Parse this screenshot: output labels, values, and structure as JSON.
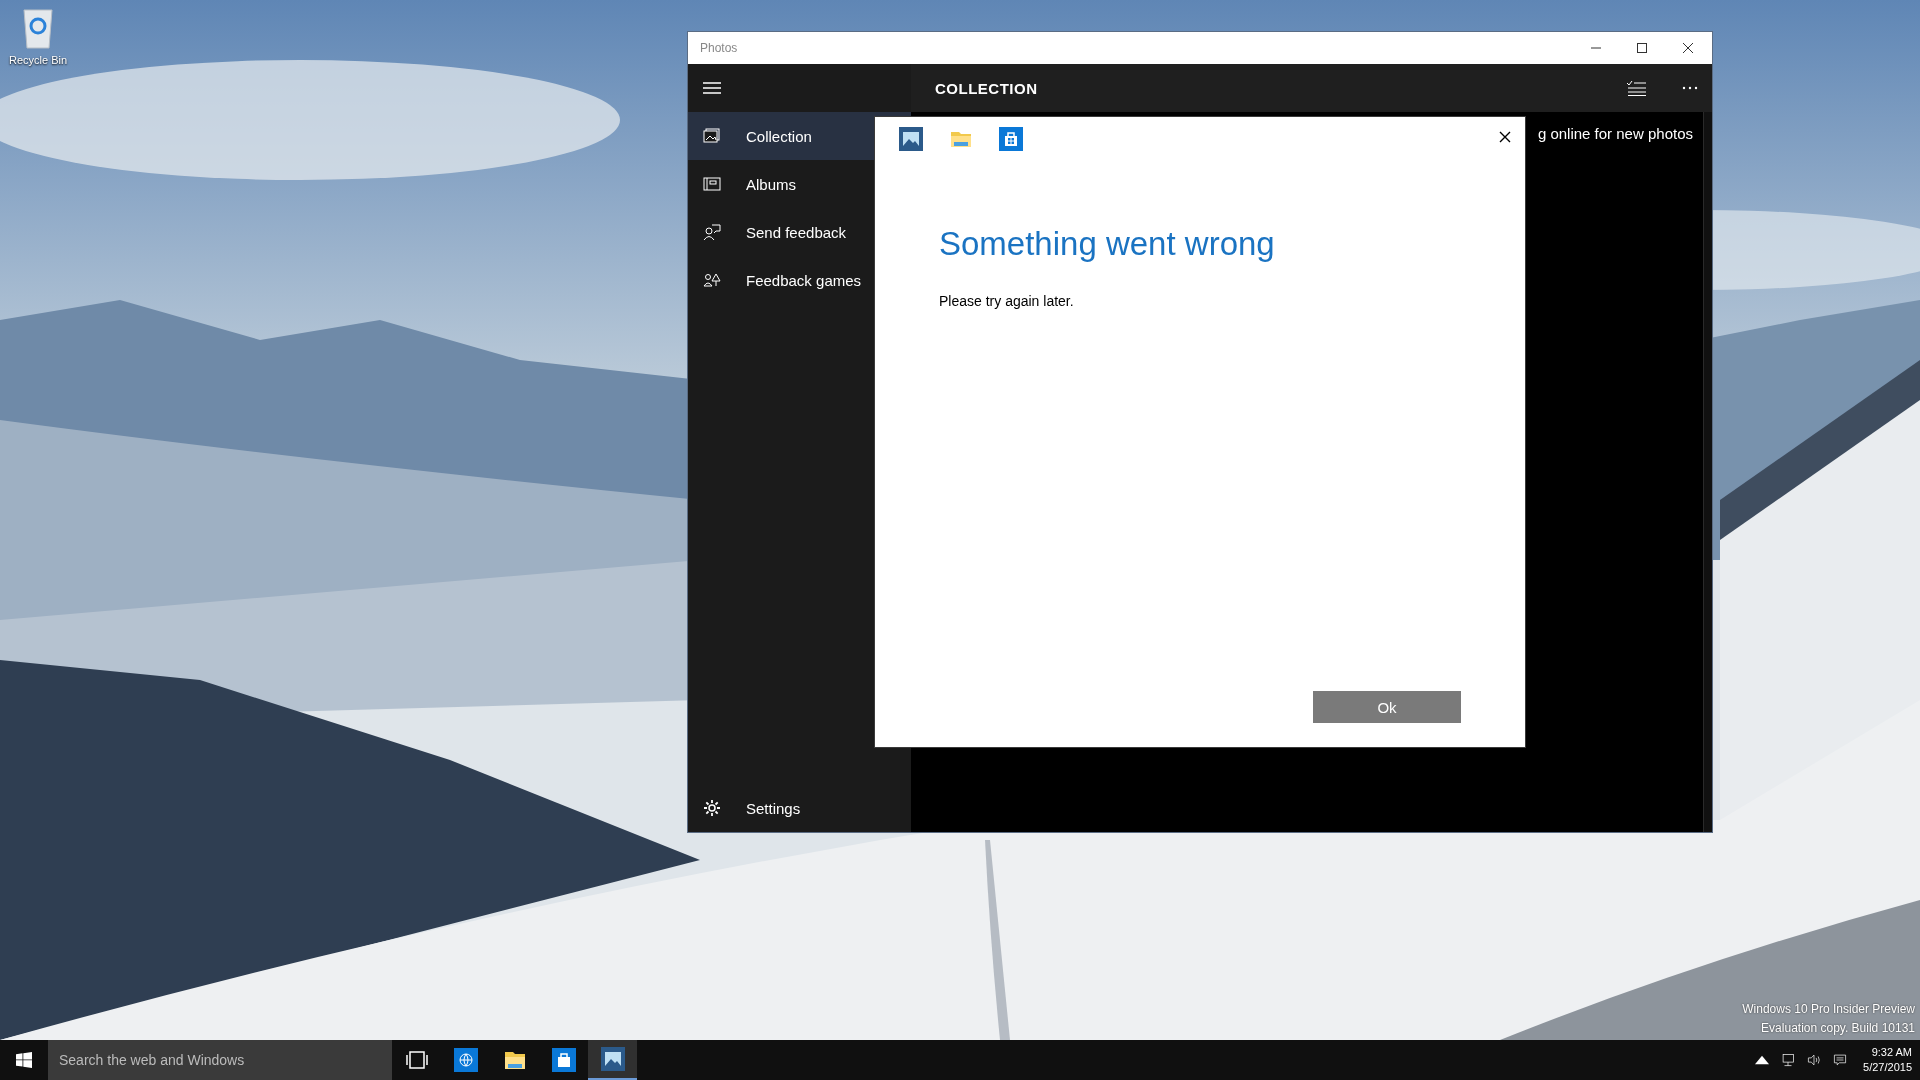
{
  "desktop": {
    "icons": [
      {
        "label": "Recycle Bin"
      }
    ],
    "watermark_lines": [
      "Windows 10 Pro Insider Preview",
      "Evaluation copy. Build 10131"
    ]
  },
  "window": {
    "title": "Photos",
    "header": "COLLECTION",
    "content_text": "g online for new photos"
  },
  "sidebar": {
    "items": [
      {
        "label": "Collection",
        "kind": "collection",
        "selected": true
      },
      {
        "label": "Albums",
        "kind": "albums",
        "selected": false
      },
      {
        "label": "Send feedback",
        "kind": "feedback",
        "selected": false
      },
      {
        "label": "Feedback games",
        "kind": "games",
        "selected": false
      }
    ],
    "footer": {
      "label": "Settings"
    }
  },
  "dialog": {
    "title": "Something went wrong",
    "message": "Please try again later.",
    "button": "Ok"
  },
  "taskbar": {
    "search": {
      "placeholder": "Search the web and Windows"
    },
    "apps": [
      {
        "kind": "taskview",
        "selected": false
      },
      {
        "kind": "browser",
        "selected": false
      },
      {
        "kind": "folder",
        "selected": false
      },
      {
        "kind": "store",
        "selected": false
      },
      {
        "kind": "photos",
        "selected": true
      }
    ],
    "time": "9:32 AM",
    "date": "5/27/2015"
  }
}
